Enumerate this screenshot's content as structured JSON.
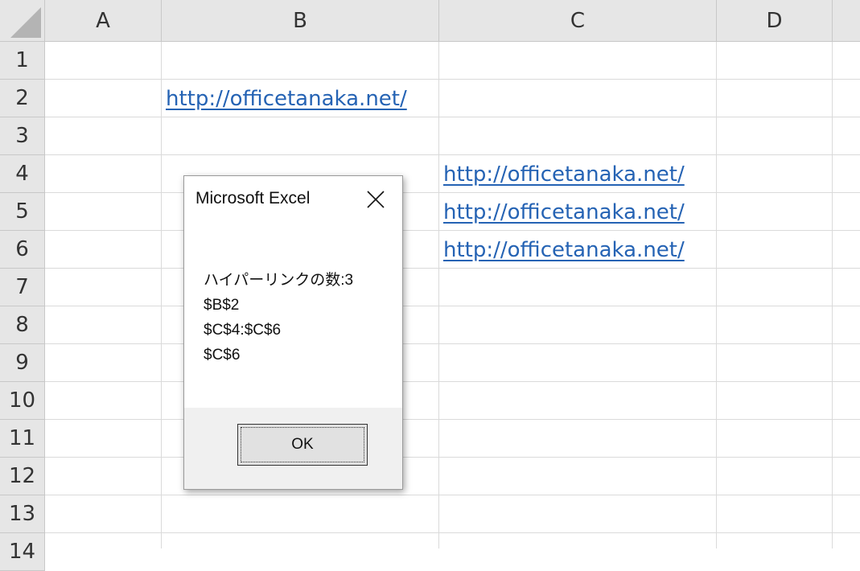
{
  "sheet": {
    "columns": [
      "A",
      "B",
      "C",
      "D"
    ],
    "rows": [
      "1",
      "2",
      "3",
      "4",
      "5",
      "6",
      "7",
      "8",
      "9",
      "10",
      "11",
      "12",
      "13",
      "14"
    ],
    "cells": {
      "B2": "http://officetanaka.net/",
      "C4": "http://officetanaka.net/",
      "C5": "http://officetanaka.net/",
      "C6": "http://officetanaka.net/"
    },
    "link_color": "#2563b4"
  },
  "dialog": {
    "title": "Microsoft Excel",
    "close_icon": "close-icon",
    "message_lines": [
      "ハイパーリンクの数:3",
      "$B$2",
      "$C$4:$C$6",
      "$C$6"
    ],
    "ok_label": "OK"
  }
}
